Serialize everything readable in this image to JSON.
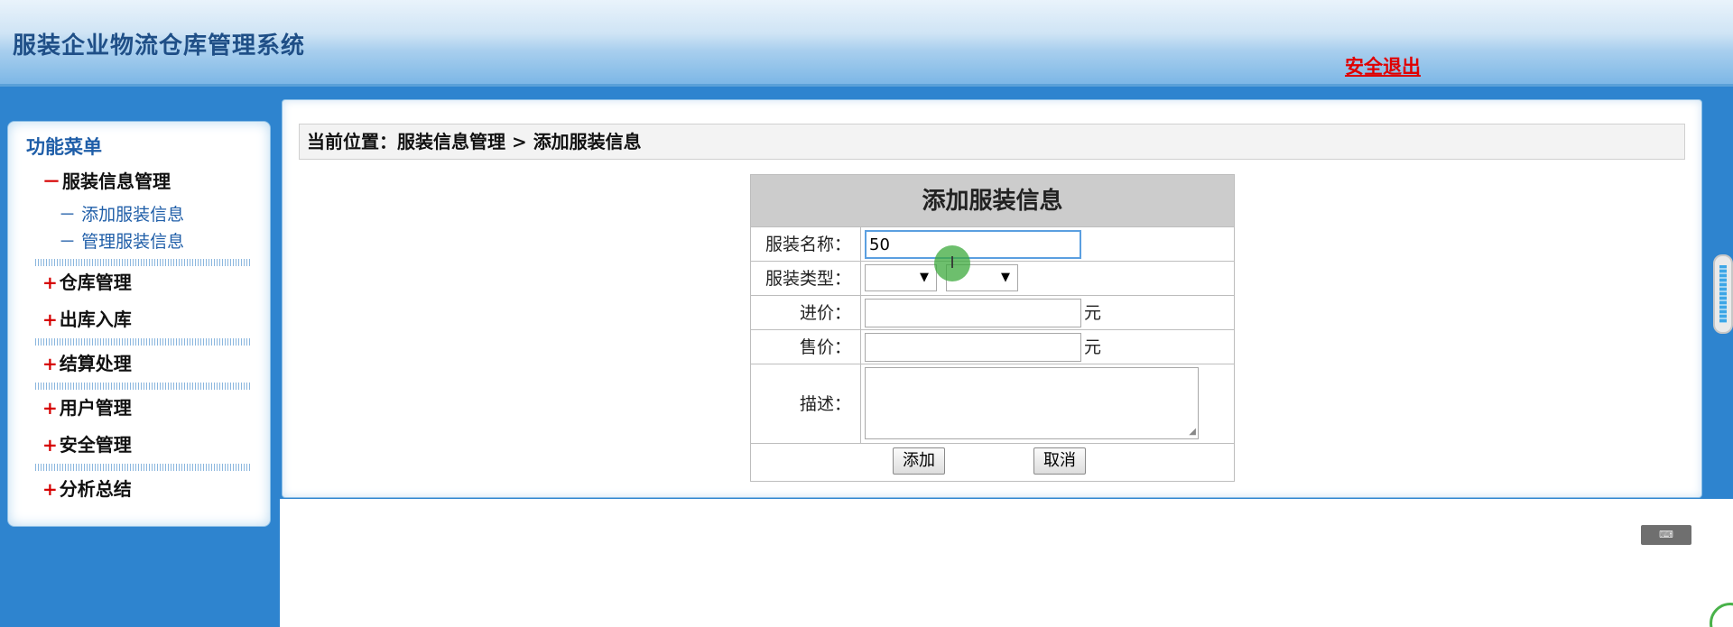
{
  "app": {
    "title": "服装企业物流仓库管理系统",
    "logout_label": "安全退出"
  },
  "sidebar": {
    "menu_title": "功能菜单",
    "expanded_group": {
      "sign": "－",
      "label": "服装信息管理",
      "items": [
        {
          "prefix": "－",
          "label": "添加服装信息"
        },
        {
          "prefix": "－",
          "label": "管理服装信息"
        }
      ]
    },
    "groups": [
      {
        "sign": "+",
        "label": "仓库管理"
      },
      {
        "sign": "+",
        "label": "出库入库"
      },
      {
        "sign": "+",
        "label": "结算处理"
      },
      {
        "sign": "+",
        "label": "用户管理"
      },
      {
        "sign": "+",
        "label": "安全管理"
      },
      {
        "sign": "+",
        "label": "分析总结"
      }
    ]
  },
  "breadcrumb": {
    "prefix": "当前位置：",
    "level1": "服装信息管理",
    "separator": " > ",
    "level2": "添加服装信息"
  },
  "form": {
    "title": "添加服装信息",
    "fields": {
      "name": {
        "label": "服装名称：",
        "value": "50"
      },
      "type": {
        "label": "服装类型：",
        "select1_value": "",
        "select2_value": "",
        "arrow": "▼"
      },
      "cost": {
        "label": "进价：",
        "value": "",
        "unit": "元"
      },
      "price": {
        "label": "售价：",
        "value": "",
        "unit": "元"
      },
      "desc": {
        "label": "描述：",
        "value": ""
      }
    },
    "buttons": {
      "add": "添加",
      "cancel": "取消"
    }
  },
  "widgets": {
    "cursor_glyph": "I",
    "textarea_grip": "◢",
    "keyboard_glyph": "⌨"
  }
}
